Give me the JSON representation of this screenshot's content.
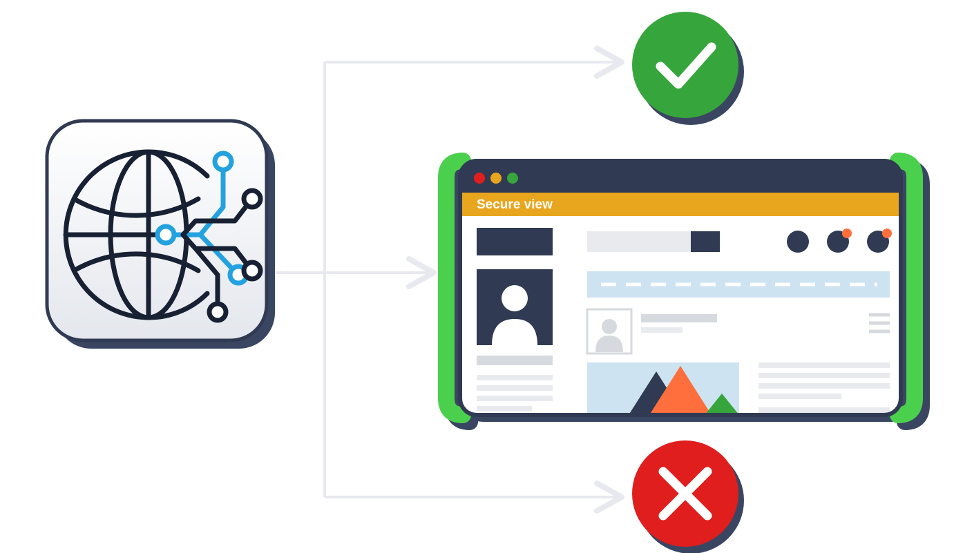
{
  "colors": {
    "navy": "#303a52",
    "navyStroke": "#182033",
    "green": "#36a63c",
    "greenBright": "#4bd04d",
    "red": "#e01e1e",
    "yellow": "#e8a61e",
    "orange": "#ff6f3d",
    "blue": "#24a2e0",
    "paleBlue": "#cde3f1",
    "grey": "#d6d9dd",
    "lightGrey": "#e8eaee",
    "shadow": "#3a4661",
    "arrow": "#e7e9ee",
    "iconGrad1": "#ffffff",
    "iconGrad2": "#e4e7ed"
  },
  "browser": {
    "titleBarLabel": "Secure view"
  },
  "diagram": {
    "sourceLabel": "internet-source",
    "topOutcome": "allowed",
    "middleOutcome": "secure-view",
    "bottomOutcome": "blocked"
  }
}
